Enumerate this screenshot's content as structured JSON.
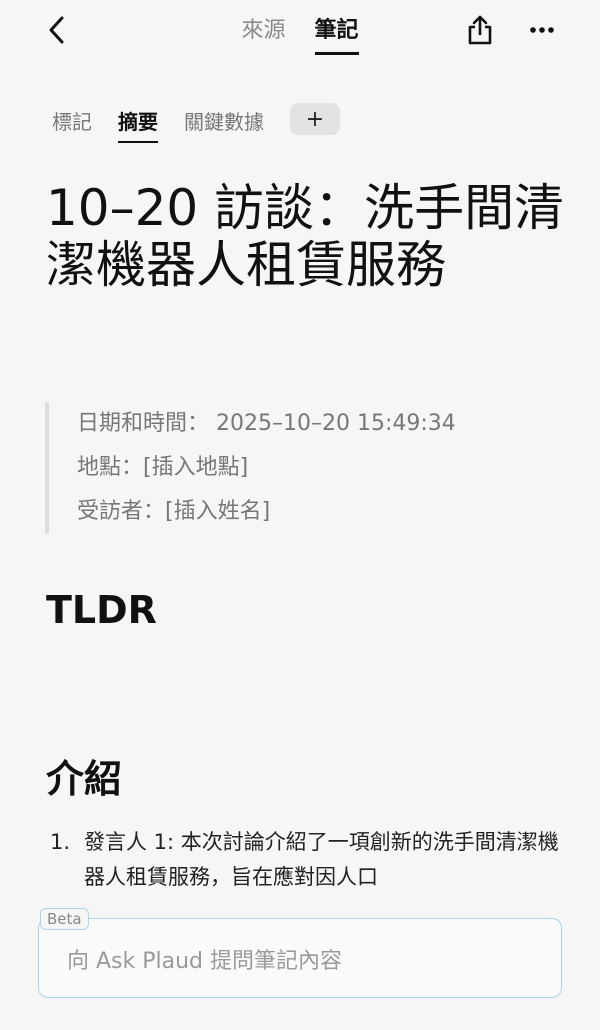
{
  "header": {
    "tabs": [
      {
        "label": "來源",
        "active": false
      },
      {
        "label": "筆記",
        "active": true
      }
    ]
  },
  "subtabs": [
    {
      "label": "標記",
      "active": false
    },
    {
      "label": "摘要",
      "active": true
    },
    {
      "label": "關鍵數據",
      "active": false
    }
  ],
  "add_tab_label": "+",
  "title": "10–20 訪談：洗手間清潔機器人租賃服務",
  "meta": {
    "datetime": "日期和時間： 2025–10–20 15:49:34",
    "location": "地點：[插入地點]",
    "interviewee": "受訪者：[插入姓名]"
  },
  "sections": {
    "tldr": "TLDR",
    "intro": "介紹"
  },
  "intro_list": [
    {
      "num": "1.",
      "text": "發言人 1: 本次討論介紹了一項創新的洗手間清潔機器人租賃服務，旨在應對因人口"
    }
  ],
  "ask": {
    "badge": "Beta",
    "placeholder": "向 Ask Plaud 提問筆記內容"
  },
  "colors": {
    "background": "#f6f6f6",
    "accent_border": "#a9d4ea"
  }
}
